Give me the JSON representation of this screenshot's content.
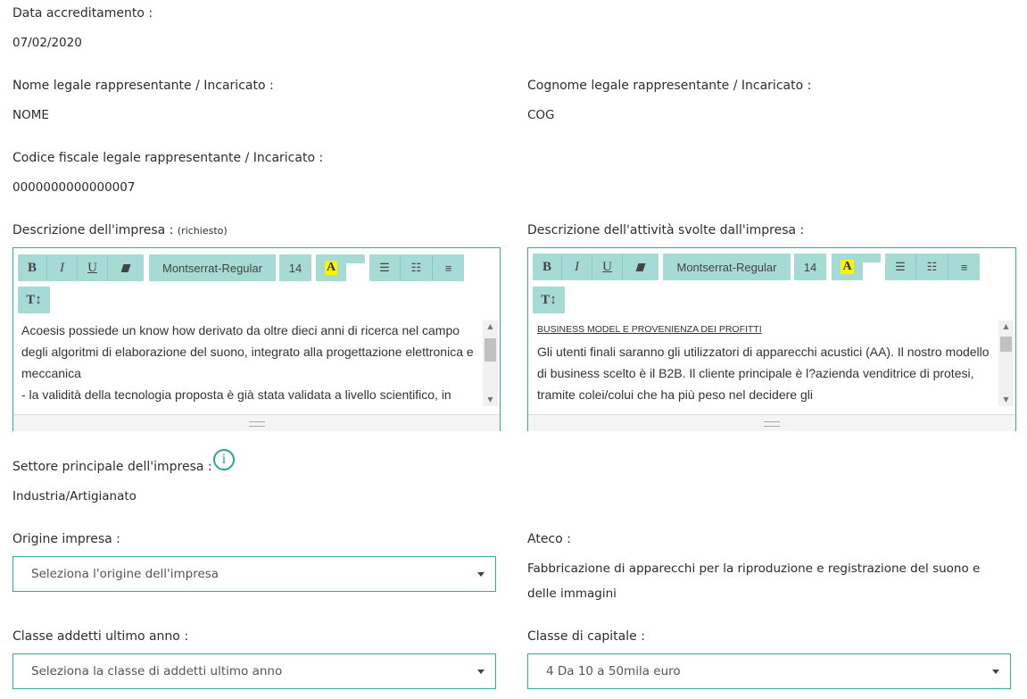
{
  "accreditamento": {
    "label": "Data accreditamento :",
    "value": "07/02/2020"
  },
  "nome": {
    "label": "Nome legale rappresentante / Incaricato :",
    "value": "NOME"
  },
  "cognome": {
    "label": "Cognome legale rappresentante / Incaricato :",
    "value": "COG"
  },
  "codice_fiscale": {
    "label": "Codice fiscale legale rappresentante / Incaricato :",
    "value": "0000000000000007"
  },
  "descrizione_impresa": {
    "label": "Descrizione dell'impresa :",
    "required": "(richiesto)",
    "toolbar": {
      "font": "Montserrat-Regular",
      "size": "14",
      "highlight": "A",
      "textsize": "T↕"
    },
    "content": [
      "Acoesis possiede un know how derivato da oltre dieci anni di ricerca nel campo degli algoritmi di elaborazione del suono, integrato alla progettazione elettronica e meccanica",
      "-    la validità della tecnologia proposta è già stata validata a livello scientifico, in"
    ]
  },
  "descrizione_attivita": {
    "label": "Descrizione dell'attività svolte dall'impresa :",
    "toolbar": {
      "font": "Montserrat-Regular",
      "size": "14",
      "highlight": "A",
      "textsize": "T↕"
    },
    "heading": "BUSINESS MODEL E PROVENIENZA DEI PROFITTI",
    "content": "Gli utenti finali saranno gli utilizzatori di apparecchi acustici (AA). Il nostro modello di business scelto è il B2B. Il cliente principale è l?azienda venditrice di protesi, tramite colei/colui che ha più peso nel decidere gli"
  },
  "settore": {
    "label": "Settore principale dell'impresa :",
    "value": "Industria/Artigianato",
    "info_icon": "i"
  },
  "origine": {
    "label": "Origine impresa :",
    "placeholder": "Seleziona l'origine dell'impresa"
  },
  "ateco": {
    "label": "Ateco :",
    "value": "Fabbricazione di apparecchi per la riproduzione e registrazione del suono e delle immagini"
  },
  "classe_addetti": {
    "label": "Classe addetti ultimo anno :",
    "placeholder": "Seleziona la classe di addetti ultimo anno"
  },
  "classe_capitale": {
    "label": "Classe di capitale :",
    "value": "4 Da 10 a 50mila euro"
  },
  "colors": {
    "accent": "#3ba99a",
    "toolbar": "#a6dad4",
    "highlight": "#fff200"
  }
}
